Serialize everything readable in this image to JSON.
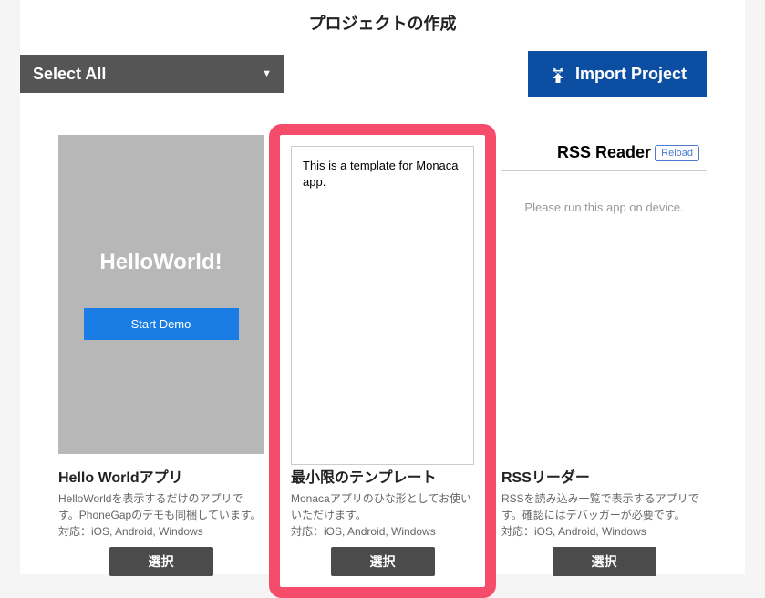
{
  "modal": {
    "title": "プロジェクトの作成",
    "select_all_label": "Select All",
    "import_label": "Import Project"
  },
  "templates": [
    {
      "preview": {
        "type": "hello",
        "headline": "HelloWorld!",
        "button": "Start Demo"
      },
      "title": "Hello Worldアプリ",
      "desc": "HelloWorldを表示するだけのアプリです。PhoneGapのデモも同梱しています。",
      "support": "対応：iOS, Android, Windows",
      "select_label": "選択"
    },
    {
      "preview": {
        "type": "minimum",
        "text": "This is a template for Monaca app."
      },
      "title": "最小限のテンプレート",
      "desc": "Monacaアプリのひな形としてお使いいただけます。",
      "support": "対応：iOS, Android, Windows",
      "select_label": "選択"
    },
    {
      "preview": {
        "type": "rss",
        "header_title": "RSS Reader",
        "reload": "Reload",
        "body": "Please run this app on device."
      },
      "title": "RSSリーダー",
      "desc": "RSSを読み込み一覧で表示するアプリです。確認にはデバッガーが必要です。",
      "support": "対応：iOS, Android, Windows",
      "select_label": "選択"
    }
  ]
}
